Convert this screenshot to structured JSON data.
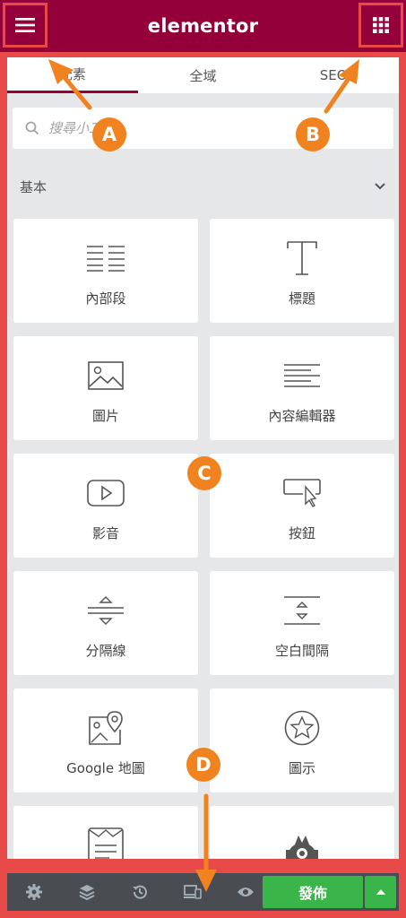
{
  "header": {
    "logo": "elementor",
    "menu_icon": "hamburger-icon",
    "apps_icon": "grid-icon"
  },
  "tabs": [
    {
      "label": "元素",
      "active": true
    },
    {
      "label": "全域",
      "active": false
    },
    {
      "label": "SEO",
      "active": false
    }
  ],
  "search": {
    "placeholder": "搜尋小工具..."
  },
  "category": {
    "title": "基本",
    "chevron_icon": "chevron-down-icon"
  },
  "widgets": [
    {
      "label": "內部段",
      "icon": "inner-section-icon"
    },
    {
      "label": "標題",
      "icon": "heading-icon"
    },
    {
      "label": "圖片",
      "icon": "image-icon"
    },
    {
      "label": "內容編輯器",
      "icon": "text-editor-icon"
    },
    {
      "label": "影音",
      "icon": "video-icon"
    },
    {
      "label": "按鈕",
      "icon": "button-icon"
    },
    {
      "label": "分隔線",
      "icon": "divider-icon"
    },
    {
      "label": "空白間隔",
      "icon": "spacer-icon"
    },
    {
      "label": "Google 地圖",
      "icon": "map-icon"
    },
    {
      "label": "圖示",
      "icon": "star-icon"
    },
    {
      "label": "",
      "icon": "form-icon"
    },
    {
      "label": "",
      "icon": "robot-icon"
    }
  ],
  "bottom_bar": {
    "tools": [
      "settings-icon",
      "layers-icon",
      "history-icon",
      "responsive-icon",
      "preview-icon"
    ],
    "publish_label": "發佈",
    "more_icon": "caret-up-icon"
  },
  "annotations": {
    "a": "A",
    "b": "B",
    "c": "C",
    "d": "D",
    "color": "#f0831f"
  },
  "colors": {
    "brand": "#93003a",
    "highlight": "#e84a4a",
    "publish": "#39b54a",
    "toolbar": "#494c51"
  }
}
